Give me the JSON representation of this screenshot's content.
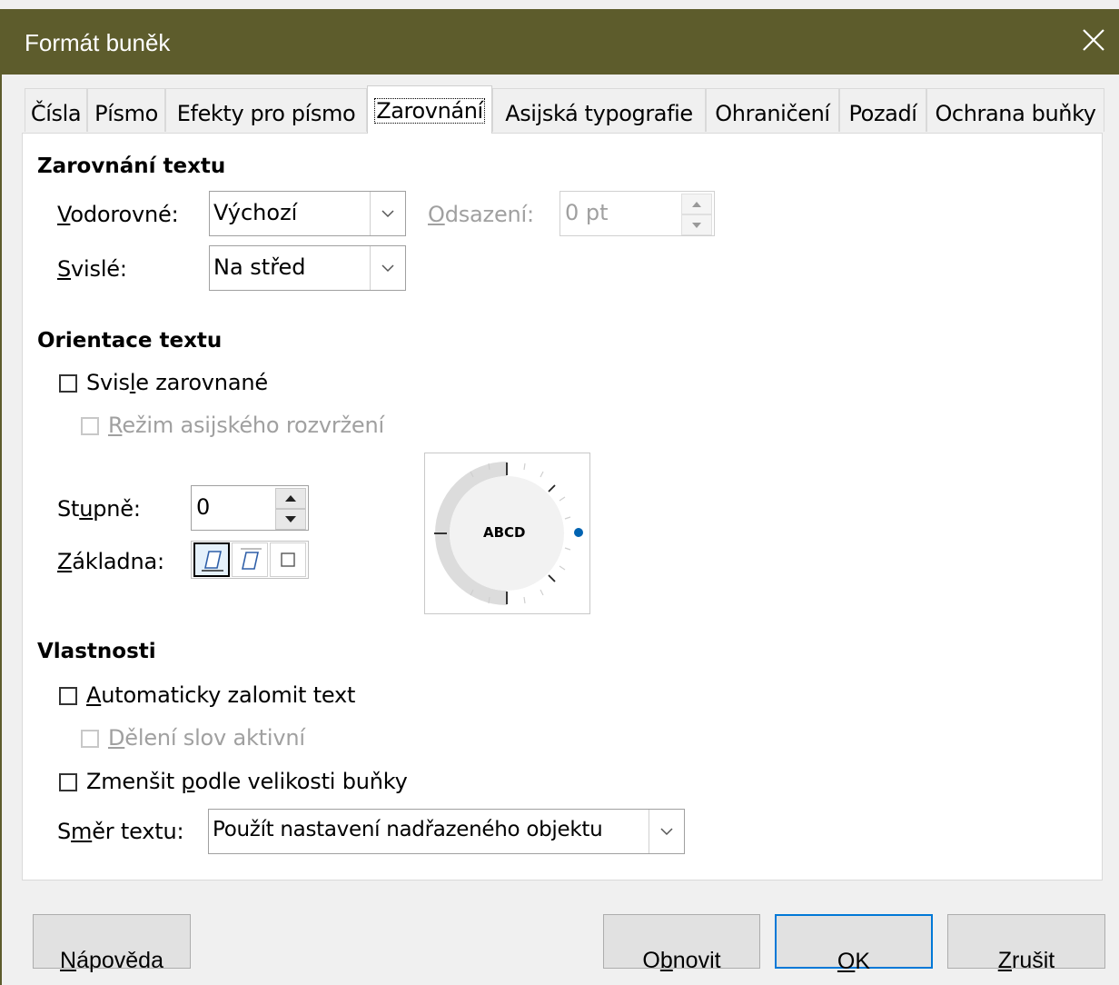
{
  "window": {
    "title": "Formát buněk",
    "title_bar_color": "#5d5c2c",
    "close_icon": "close-icon"
  },
  "tabs": [
    {
      "label": "Čísla",
      "active": false
    },
    {
      "label": "Písmo",
      "active": false
    },
    {
      "label": "Efekty pro písmo",
      "active": false
    },
    {
      "label": "Zarovnání",
      "active": true
    },
    {
      "label": "Asijská typografie",
      "active": false
    },
    {
      "label": "Ohraničení",
      "active": false
    },
    {
      "label": "Pozadí",
      "active": false
    },
    {
      "label": "Ochrana buňky",
      "active": false
    }
  ],
  "text_alignment": {
    "heading": "Zarovnání textu",
    "horizontal": {
      "label_pre": "",
      "label_u": "V",
      "label_post": "odorovné:",
      "value": "Výchozí"
    },
    "indent": {
      "label_pre": "",
      "label_u": "O",
      "label_post": "dsazení:",
      "value": "0 pt",
      "disabled": true
    },
    "vertical": {
      "label_pre": "",
      "label_u": "S",
      "label_post": "vislé:",
      "value": "Na střed"
    }
  },
  "text_orientation": {
    "heading": "Orientace textu",
    "vertically_stacked": {
      "label_pre": "Svis",
      "label_u": "l",
      "label_post": "e zarovnané",
      "checked": false
    },
    "asian_layout": {
      "label_pre": "",
      "label_u": "R",
      "label_post": "ežim asijského rozvržení",
      "checked": false,
      "disabled": true
    },
    "degrees": {
      "label_pre": "St",
      "label_u": "u",
      "label_post": "pně:",
      "value": "0"
    },
    "reference_edge": {
      "label_pre": "",
      "label_u": "Z",
      "label_post": "ákladna:",
      "options": [
        "text-extension-from-lower-edge-icon",
        "text-extension-from-upper-edge-icon",
        "text-extension-inside-cell-icon"
      ],
      "selected": 0
    },
    "dial": {
      "sample_text": "ABCD",
      "angle_degrees": 0,
      "indicator_color": "#0063b1"
    }
  },
  "properties": {
    "heading": "Vlastnosti",
    "wrap_text": {
      "label_pre": "",
      "label_u": "A",
      "label_post": "utomaticky zalomit text",
      "checked": false
    },
    "hyphenation": {
      "label_pre": "",
      "label_u": "D",
      "label_post": "ělení slov aktivní",
      "checked": false,
      "disabled": true
    },
    "shrink_to_fit": {
      "label_pre": "Zmenšit ",
      "label_u": "p",
      "label_post": "odle velikosti buňky",
      "checked": false
    },
    "text_direction": {
      "label_pre": "S",
      "label_u": "m",
      "label_post": "ěr textu:",
      "value": "Použít nastavení nadřazeného objektu"
    }
  },
  "buttons": {
    "help": {
      "label_pre": "",
      "label_u": "N",
      "label_post": "ápověda"
    },
    "reset": {
      "label_pre": "O",
      "label_u": "b",
      "label_post": "novit"
    },
    "ok": {
      "label_pre": "",
      "label_u": "O",
      "label_post": "K"
    },
    "cancel": {
      "label_pre": "",
      "label_u": "Z",
      "label_post": "rušit"
    }
  },
  "colors": {
    "accent": "#0078d7"
  }
}
